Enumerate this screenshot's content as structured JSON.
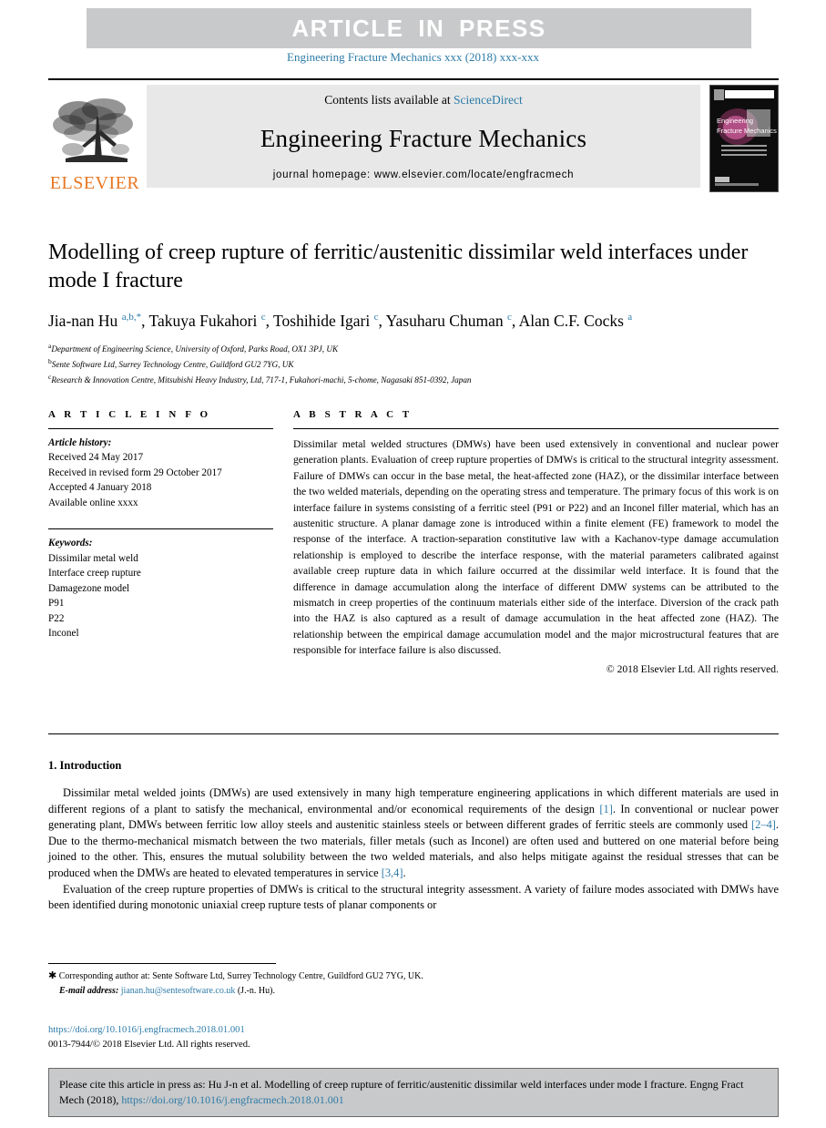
{
  "banner": {
    "text": "ARTICLE  IN  PRESS",
    "background": "#c8c9ca",
    "text_color": "#ffffff"
  },
  "journal_ref": "Engineering Fracture Mechanics xxx (2018) xxx-xxx",
  "masthead": {
    "publisher_name": "ELSEVIER",
    "publisher_color": "#e87722",
    "contents_prefix": "Contents lists available at ",
    "contents_link": "ScienceDirect",
    "link_color": "#2d7ba8",
    "journal_title": "Engineering Fracture Mechanics",
    "homepage": "journal homepage: www.elsevier.com/locate/engfracmech",
    "cover_line1": "Engineering",
    "cover_line2": "Fracture Mechanics"
  },
  "article": {
    "title": "Modelling of creep rupture of ferritic/austenitic dissimilar weld interfaces under mode I fracture",
    "authors_html": "Jia-nan Hu <sup>a,b,</sup><sup>*</sup>, Takuya Fukahori <sup>c</sup>, Toshihide Igari <sup>c</sup>, Yasuharu Chuman <sup>c</sup>, Alan C.F. Cocks <sup>a</sup>",
    "affiliations": [
      {
        "marker": "a",
        "text": "Department of Engineering Science, University of Oxford, Parks Road, OX1 3PJ, UK"
      },
      {
        "marker": "b",
        "text": "Sente Software Ltd, Surrey Technology Centre, Guildford GU2 7YG, UK"
      },
      {
        "marker": "c",
        "text": "Research & Innovation Centre, Mitsubishi Heavy Industry, Ltd, 717-1, Fukahori-machi, 5-chome, Nagasaki 851-0392, Japan"
      }
    ]
  },
  "article_info": {
    "heading": "A R T I C L E   I N F O",
    "history_label": "Article history:",
    "history": [
      "Received 24 May 2017",
      "Received in revised form 29 October 2017",
      "Accepted 4 January 2018",
      "Available online xxxx"
    ],
    "keywords_label": "Keywords:",
    "keywords": [
      "Dissimilar metal weld",
      "Interface creep rupture",
      "Damagezone model",
      "P91",
      "P22",
      "Inconel"
    ]
  },
  "abstract": {
    "heading": "A B S T R A C T",
    "body": "Dissimilar metal welded structures (DMWs) have been used extensively in conventional and nuclear power generation plants. Evaluation of creep rupture properties of DMWs is critical to the structural integrity assessment. Failure of DMWs can occur in the base metal, the heat-affected zone (HAZ), or the dissimilar interface between the two welded materials, depending on the operating stress and temperature. The primary focus of this work is on interface failure in systems consisting of a ferritic steel (P91 or P22) and an Inconel filler material, which has an austenitic structure. A planar damage zone is introduced within a finite element (FE) framework to model the response of the interface. A traction-separation constitutive law with a Kachanov-type damage accumulation relationship is employed to describe the interface response, with the material parameters calibrated against available creep rupture data in which failure occurred at the dissimilar weld interface. It is found that the difference in damage accumulation along the interface of different DMW systems can be attributed to the mismatch in creep properties of the continuum materials either side of the interface. Diversion of the crack path into the HAZ is also captured as a result of damage accumulation in the heat affected zone (HAZ). The relationship between the empirical damage accumulation model and the major microstructural features that are responsible for interface failure is also discussed.",
    "copyright": "© 2018 Elsevier Ltd. All rights reserved."
  },
  "introduction": {
    "heading": "1. Introduction",
    "paragraph1_html": "Dissimilar metal welded joints (DMWs) are used extensively in many high temperature engineering applications in which different materials are used in different regions of a plant to satisfy the mechanical, environmental and/or economical requirements of the design <span class=\"ref\">[1]</span>. In conventional or nuclear power generating plant, DMWs between ferritic low alloy steels and austenitic stainless steels or between different grades of ferritic steels are commonly used <span class=\"ref\">[2–4]</span>. Due to the thermo-mechanical mismatch between the two materials, filler metals (such as Inconel) are often used and buttered on one material before being joined to the other. This, ensures the mutual solubility between the two welded materials, and also helps mitigate against the residual stresses that can be produced when the DMWs are heated to elevated temperatures in service <span class=\"ref\">[3,4]</span>.",
    "paragraph2": "Evaluation of the creep rupture properties of DMWs is critical to the structural integrity assessment. A variety of failure modes associated with DMWs have been identified during monotonic uniaxial creep rupture tests of planar components or"
  },
  "footnotes": {
    "corresponding_html": "<span class=\"star\">&#10033;</span> Corresponding author at: Sente Software Ltd, Surrey Technology Centre, Guildford GU2 7YG, UK.",
    "email_label": "E-mail address:",
    "email": "jianan.hu@sentesoftware.co.uk",
    "email_suffix": "(J.-n. Hu).",
    "doi": "https://doi.org/10.1016/j.engfracmech.2018.01.001",
    "issn_line": "0013-7944/© 2018 Elsevier Ltd. All rights reserved."
  },
  "cite_box": {
    "text_before": "Please cite this article in press as: Hu J-n et al. Modelling of creep rupture of ferritic/austenitic dissimilar weld interfaces under mode I fracture. Engng Fract Mech (2018), ",
    "link": "https://doi.org/10.1016/j.engfracmech.2018.01.001",
    "background": "#c8c9ca"
  }
}
